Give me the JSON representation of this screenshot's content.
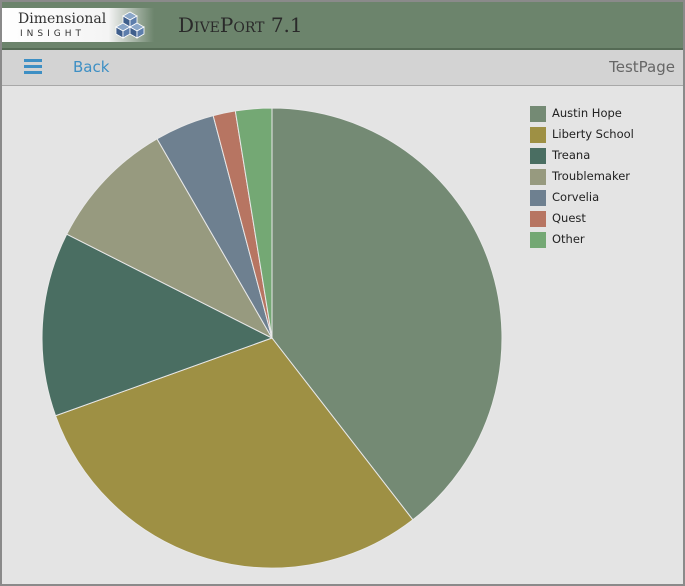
{
  "header": {
    "logo_text": "Dimensional",
    "logo_sub": "INSIGHT",
    "app_title": "DivePort 7.1"
  },
  "nav": {
    "back_label": "Back",
    "page_name": "TestPage"
  },
  "chart_data": {
    "type": "pie",
    "start": "12 o'clock",
    "direction": "clockwise",
    "legend_position": "top-right",
    "slices": [
      {
        "label": "Austin Hope",
        "percent": 40.3,
        "color": "#748a74"
      },
      {
        "label": "Liberty School",
        "percent": 30.6,
        "color": "#9e9044"
      },
      {
        "label": "Treana",
        "percent": 13.2,
        "color": "#4a6e62"
      },
      {
        "label": "Troublemaker",
        "percent": 9.4,
        "color": "#979a7f"
      },
      {
        "label": "Corvelia",
        "percent": 4.3,
        "color": "#6e8090"
      },
      {
        "label": "Quest",
        "percent": 1.6,
        "color": "#b77562"
      },
      {
        "label": "Other",
        "percent": 2.6,
        "color": "#74a874"
      }
    ]
  }
}
